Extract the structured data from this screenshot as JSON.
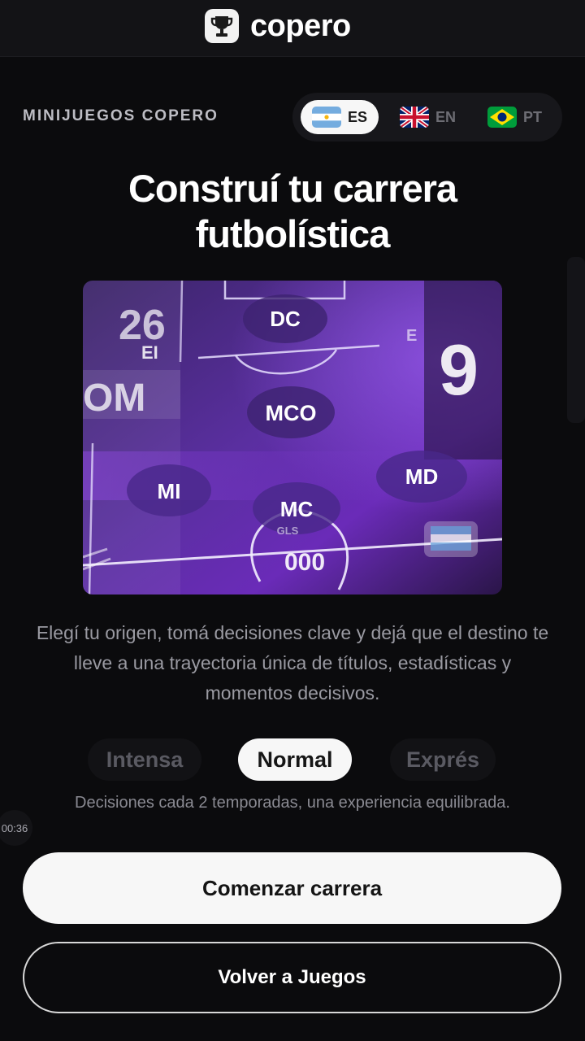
{
  "header": {
    "app_name": "copero",
    "logo_icon": "trophy-icon"
  },
  "section_label": "MINIJUEGOS COPERO",
  "languages": [
    {
      "code": "ES",
      "flag": "argentina-flag",
      "active": true
    },
    {
      "code": "EN",
      "flag": "uk-flag",
      "active": false
    },
    {
      "code": "PT",
      "flag": "brazil-flag",
      "active": false
    }
  ],
  "title_line1": "Construí tu carrera",
  "title_line2": "futbolística",
  "pitch": {
    "positions": [
      "DC",
      "MCO",
      "MI",
      "MD",
      "MC"
    ],
    "card_number_left": "26",
    "card_number_right": "9",
    "card_text": "OM",
    "left_label": "EI",
    "right_label": "E",
    "score_label": "GLS",
    "score": "000"
  },
  "description": "Elegí tu origen, tomá decisiones clave y dejá que el destino te lleve a una trayectoria única de títulos, estadísticas y momentos decisivos.",
  "modes": [
    {
      "label": "Intensa",
      "active": false
    },
    {
      "label": "Normal",
      "active": true
    },
    {
      "label": "Exprés",
      "active": false
    }
  ],
  "mode_description": "Decisiones cada 2 temporadas, una experiencia equilibrada.",
  "timer": "00:36",
  "primary_button": "Comenzar carrera",
  "secondary_button": "Volver a Juegos",
  "colors": {
    "background": "#0b0b0d",
    "accent_purple": "#6a2bb8",
    "button_light": "#f7f7f7"
  }
}
